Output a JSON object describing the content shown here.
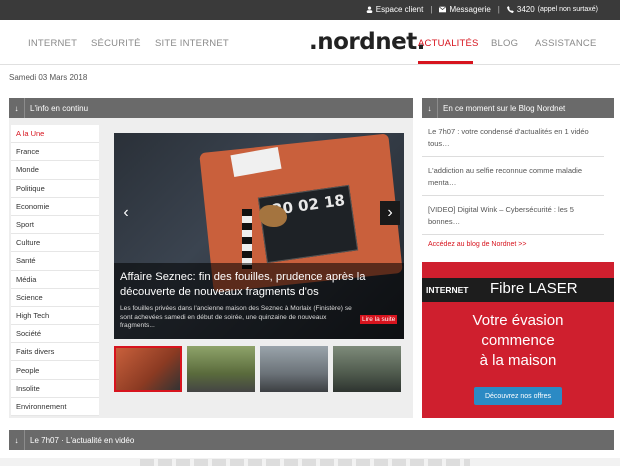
{
  "topbar": {
    "espace_client": "Espace client",
    "messagerie": "Messagerie",
    "phone": "3420",
    "phone_note": "(appel non surtaxé)"
  },
  "nav": {
    "left": [
      "INTERNET",
      "SÉCURITÉ",
      "SITE INTERNET"
    ],
    "right": [
      "ACTUALITÉS",
      "BLOG",
      "ASSISTANCE"
    ],
    "logo": ".nordnet."
  },
  "date": "Samedi 03 Mars 2018",
  "info_section": {
    "title": "L'info en continu"
  },
  "menu": [
    "A la Une",
    "France",
    "Monde",
    "Politique",
    "Economie",
    "Sport",
    "Culture",
    "Santé",
    "Média",
    "Science",
    "High Tech",
    "Société",
    "Faits divers",
    "People",
    "Insolite",
    "Environnement"
  ],
  "slide": {
    "title": "Affaire Seznec: fin des fouilles, prudence après la découverte de nouveaux fragments d'os",
    "text": "Les fouilles privées dans l'ancienne maison des Seznec à Morlaix (Finistère) se sont achevées samedi en début de soirée, une quinzaine de nouveaux fragments...",
    "more": "Lire la suite",
    "plate": "20 02 18"
  },
  "blog_section": {
    "title": "En ce moment sur le Blog Nordnet"
  },
  "blog": {
    "items": [
      "Le 7h07 : votre condensé d'actualités en 1 vidéo tous…",
      "L'addiction au selfie reconnue comme maladie menta…",
      "[VIDEO] Digital Wink – Cybersécurité : les 5 bonnes…"
    ],
    "link": "Accédez au blog de Nordnet >>"
  },
  "ad": {
    "brand": "INTERNET",
    "product": "Fibre LASER",
    "line1": "Votre évasion",
    "line2": "commence",
    "line3": "à la maison",
    "cta": "Découvrez nos offres"
  },
  "video_section": {
    "title": "Le 7h07 · L'actualité en vidéo"
  },
  "colors": {
    "accent": "#d7141e",
    "bar": "#6a6a6a",
    "topbar": "#3a3a3a",
    "ad": "#cf1f2e"
  }
}
